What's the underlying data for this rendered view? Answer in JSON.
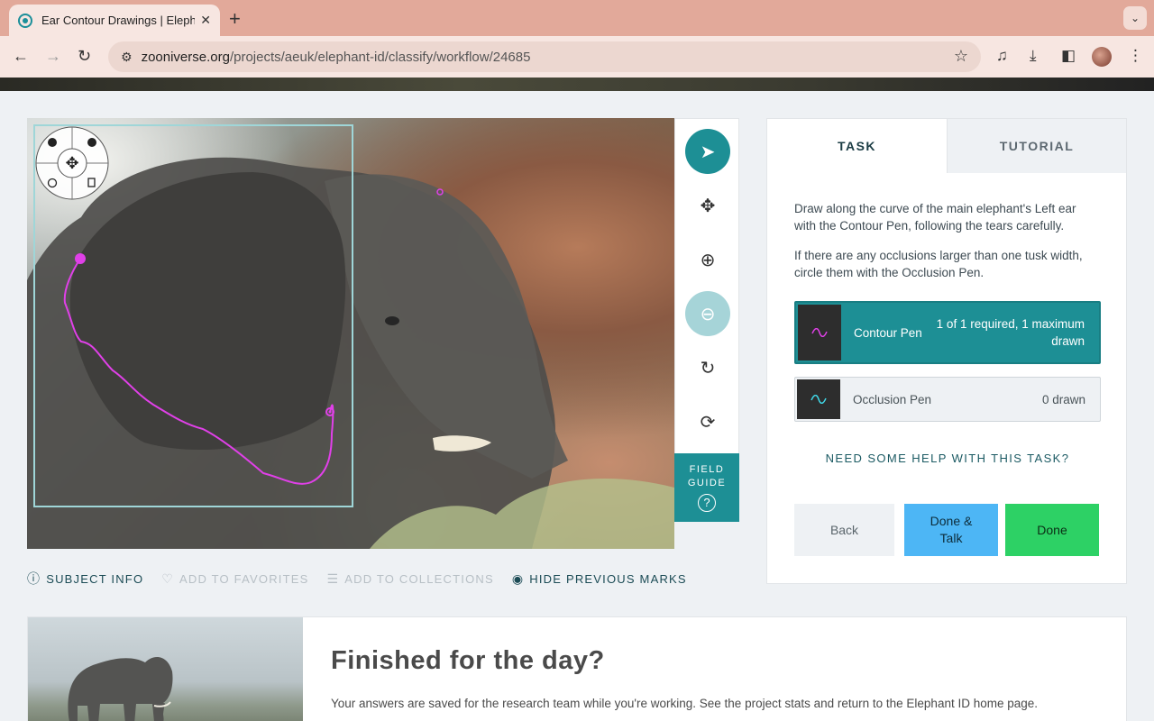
{
  "browser": {
    "tab_title": "Ear Contour Drawings | Eleph",
    "url_domain": "zooniverse.org",
    "url_path": "/projects/aeuk/elephant-id/classify/workflow/24685"
  },
  "subject_tools": {
    "field_guide_label": "FIELD\nGUIDE",
    "field_guide_q": "?"
  },
  "subject_links": {
    "subject_info": "SUBJECT INFO",
    "add_favorites": "ADD TO FAVORITES",
    "add_collections": "ADD TO COLLECTIONS",
    "hide_marks": "HIDE PREVIOUS MARKS"
  },
  "task_panel": {
    "tab_task": "TASK",
    "tab_tutorial": "TUTORIAL",
    "instruction_1": "Draw along the curve of the main elephant's Left ear with the Contour Pen, following the tears carefully.",
    "instruction_2": "If there are any occlusions larger than one tusk width, circle them with the Occlusion Pen.",
    "tools": [
      {
        "name": "Contour Pen",
        "count": "1 of 1 required, 1 maximum drawn",
        "color": "#e040e8"
      },
      {
        "name": "Occlusion Pen",
        "count": "0 drawn",
        "color": "#40d8e8"
      }
    ],
    "help_link": "NEED SOME HELP WITH THIS TASK?",
    "back_label": "Back",
    "done_talk_label": "Done & Talk",
    "done_label": "Done"
  },
  "finish_card": {
    "title": "Finished for the day?",
    "description": "Your answers are saved for the research team while you're working. See the project stats and return to the Elephant ID home page."
  },
  "colors": {
    "teal": "#1d8f95",
    "contour": "#e040e8",
    "occlusion": "#40d8e8",
    "done_talk": "#4db6f5",
    "done": "#2dd165"
  }
}
